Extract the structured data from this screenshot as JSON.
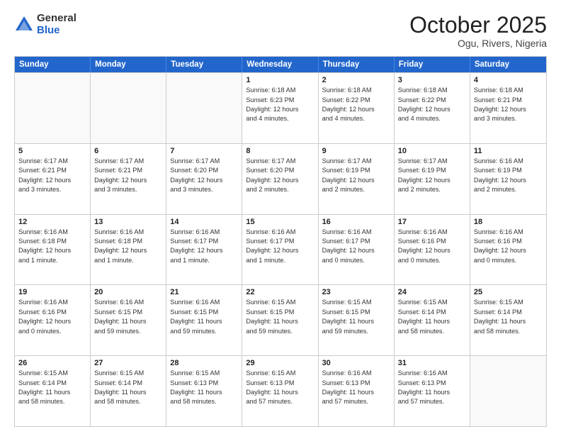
{
  "logo": {
    "general": "General",
    "blue": "Blue"
  },
  "header": {
    "title": "October 2025",
    "subtitle": "Ogu, Rivers, Nigeria"
  },
  "weekdays": [
    "Sunday",
    "Monday",
    "Tuesday",
    "Wednesday",
    "Thursday",
    "Friday",
    "Saturday"
  ],
  "weeks": [
    [
      {
        "day": "",
        "lines": []
      },
      {
        "day": "",
        "lines": []
      },
      {
        "day": "",
        "lines": []
      },
      {
        "day": "1",
        "lines": [
          "Sunrise: 6:18 AM",
          "Sunset: 6:23 PM",
          "Daylight: 12 hours",
          "and 4 minutes."
        ]
      },
      {
        "day": "2",
        "lines": [
          "Sunrise: 6:18 AM",
          "Sunset: 6:22 PM",
          "Daylight: 12 hours",
          "and 4 minutes."
        ]
      },
      {
        "day": "3",
        "lines": [
          "Sunrise: 6:18 AM",
          "Sunset: 6:22 PM",
          "Daylight: 12 hours",
          "and 4 minutes."
        ]
      },
      {
        "day": "4",
        "lines": [
          "Sunrise: 6:18 AM",
          "Sunset: 6:21 PM",
          "Daylight: 12 hours",
          "and 3 minutes."
        ]
      }
    ],
    [
      {
        "day": "5",
        "lines": [
          "Sunrise: 6:17 AM",
          "Sunset: 6:21 PM",
          "Daylight: 12 hours",
          "and 3 minutes."
        ]
      },
      {
        "day": "6",
        "lines": [
          "Sunrise: 6:17 AM",
          "Sunset: 6:21 PM",
          "Daylight: 12 hours",
          "and 3 minutes."
        ]
      },
      {
        "day": "7",
        "lines": [
          "Sunrise: 6:17 AM",
          "Sunset: 6:20 PM",
          "Daylight: 12 hours",
          "and 3 minutes."
        ]
      },
      {
        "day": "8",
        "lines": [
          "Sunrise: 6:17 AM",
          "Sunset: 6:20 PM",
          "Daylight: 12 hours",
          "and 2 minutes."
        ]
      },
      {
        "day": "9",
        "lines": [
          "Sunrise: 6:17 AM",
          "Sunset: 6:19 PM",
          "Daylight: 12 hours",
          "and 2 minutes."
        ]
      },
      {
        "day": "10",
        "lines": [
          "Sunrise: 6:17 AM",
          "Sunset: 6:19 PM",
          "Daylight: 12 hours",
          "and 2 minutes."
        ]
      },
      {
        "day": "11",
        "lines": [
          "Sunrise: 6:16 AM",
          "Sunset: 6:19 PM",
          "Daylight: 12 hours",
          "and 2 minutes."
        ]
      }
    ],
    [
      {
        "day": "12",
        "lines": [
          "Sunrise: 6:16 AM",
          "Sunset: 6:18 PM",
          "Daylight: 12 hours",
          "and 1 minute."
        ]
      },
      {
        "day": "13",
        "lines": [
          "Sunrise: 6:16 AM",
          "Sunset: 6:18 PM",
          "Daylight: 12 hours",
          "and 1 minute."
        ]
      },
      {
        "day": "14",
        "lines": [
          "Sunrise: 6:16 AM",
          "Sunset: 6:17 PM",
          "Daylight: 12 hours",
          "and 1 minute."
        ]
      },
      {
        "day": "15",
        "lines": [
          "Sunrise: 6:16 AM",
          "Sunset: 6:17 PM",
          "Daylight: 12 hours",
          "and 1 minute."
        ]
      },
      {
        "day": "16",
        "lines": [
          "Sunrise: 6:16 AM",
          "Sunset: 6:17 PM",
          "Daylight: 12 hours",
          "and 0 minutes."
        ]
      },
      {
        "day": "17",
        "lines": [
          "Sunrise: 6:16 AM",
          "Sunset: 6:16 PM",
          "Daylight: 12 hours",
          "and 0 minutes."
        ]
      },
      {
        "day": "18",
        "lines": [
          "Sunrise: 6:16 AM",
          "Sunset: 6:16 PM",
          "Daylight: 12 hours",
          "and 0 minutes."
        ]
      }
    ],
    [
      {
        "day": "19",
        "lines": [
          "Sunrise: 6:16 AM",
          "Sunset: 6:16 PM",
          "Daylight: 12 hours",
          "and 0 minutes."
        ]
      },
      {
        "day": "20",
        "lines": [
          "Sunrise: 6:16 AM",
          "Sunset: 6:15 PM",
          "Daylight: 11 hours",
          "and 59 minutes."
        ]
      },
      {
        "day": "21",
        "lines": [
          "Sunrise: 6:16 AM",
          "Sunset: 6:15 PM",
          "Daylight: 11 hours",
          "and 59 minutes."
        ]
      },
      {
        "day": "22",
        "lines": [
          "Sunrise: 6:15 AM",
          "Sunset: 6:15 PM",
          "Daylight: 11 hours",
          "and 59 minutes."
        ]
      },
      {
        "day": "23",
        "lines": [
          "Sunrise: 6:15 AM",
          "Sunset: 6:15 PM",
          "Daylight: 11 hours",
          "and 59 minutes."
        ]
      },
      {
        "day": "24",
        "lines": [
          "Sunrise: 6:15 AM",
          "Sunset: 6:14 PM",
          "Daylight: 11 hours",
          "and 58 minutes."
        ]
      },
      {
        "day": "25",
        "lines": [
          "Sunrise: 6:15 AM",
          "Sunset: 6:14 PM",
          "Daylight: 11 hours",
          "and 58 minutes."
        ]
      }
    ],
    [
      {
        "day": "26",
        "lines": [
          "Sunrise: 6:15 AM",
          "Sunset: 6:14 PM",
          "Daylight: 11 hours",
          "and 58 minutes."
        ]
      },
      {
        "day": "27",
        "lines": [
          "Sunrise: 6:15 AM",
          "Sunset: 6:14 PM",
          "Daylight: 11 hours",
          "and 58 minutes."
        ]
      },
      {
        "day": "28",
        "lines": [
          "Sunrise: 6:15 AM",
          "Sunset: 6:13 PM",
          "Daylight: 11 hours",
          "and 58 minutes."
        ]
      },
      {
        "day": "29",
        "lines": [
          "Sunrise: 6:15 AM",
          "Sunset: 6:13 PM",
          "Daylight: 11 hours",
          "and 57 minutes."
        ]
      },
      {
        "day": "30",
        "lines": [
          "Sunrise: 6:16 AM",
          "Sunset: 6:13 PM",
          "Daylight: 11 hours",
          "and 57 minutes."
        ]
      },
      {
        "day": "31",
        "lines": [
          "Sunrise: 6:16 AM",
          "Sunset: 6:13 PM",
          "Daylight: 11 hours",
          "and 57 minutes."
        ]
      },
      {
        "day": "",
        "lines": []
      }
    ]
  ]
}
